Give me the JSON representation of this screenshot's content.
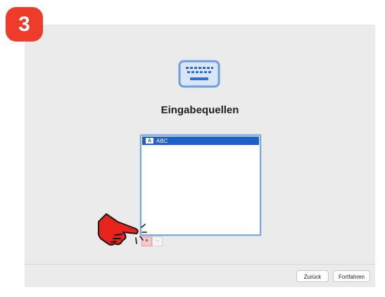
{
  "step": {
    "number": "3",
    "color": "#ee3b2a"
  },
  "header": {
    "icon": "keyboard-icon",
    "title": "Eingabequellen"
  },
  "input_sources": {
    "items": [
      {
        "flag": "A",
        "label": "ABC",
        "selected": true
      }
    ],
    "add_label": "+",
    "remove_label": "−"
  },
  "annotation": {
    "icon": "pointing-hand-icon",
    "color": "#e8231c"
  },
  "footer": {
    "back_label": "Zurück",
    "continue_label": "Fortfahren"
  }
}
